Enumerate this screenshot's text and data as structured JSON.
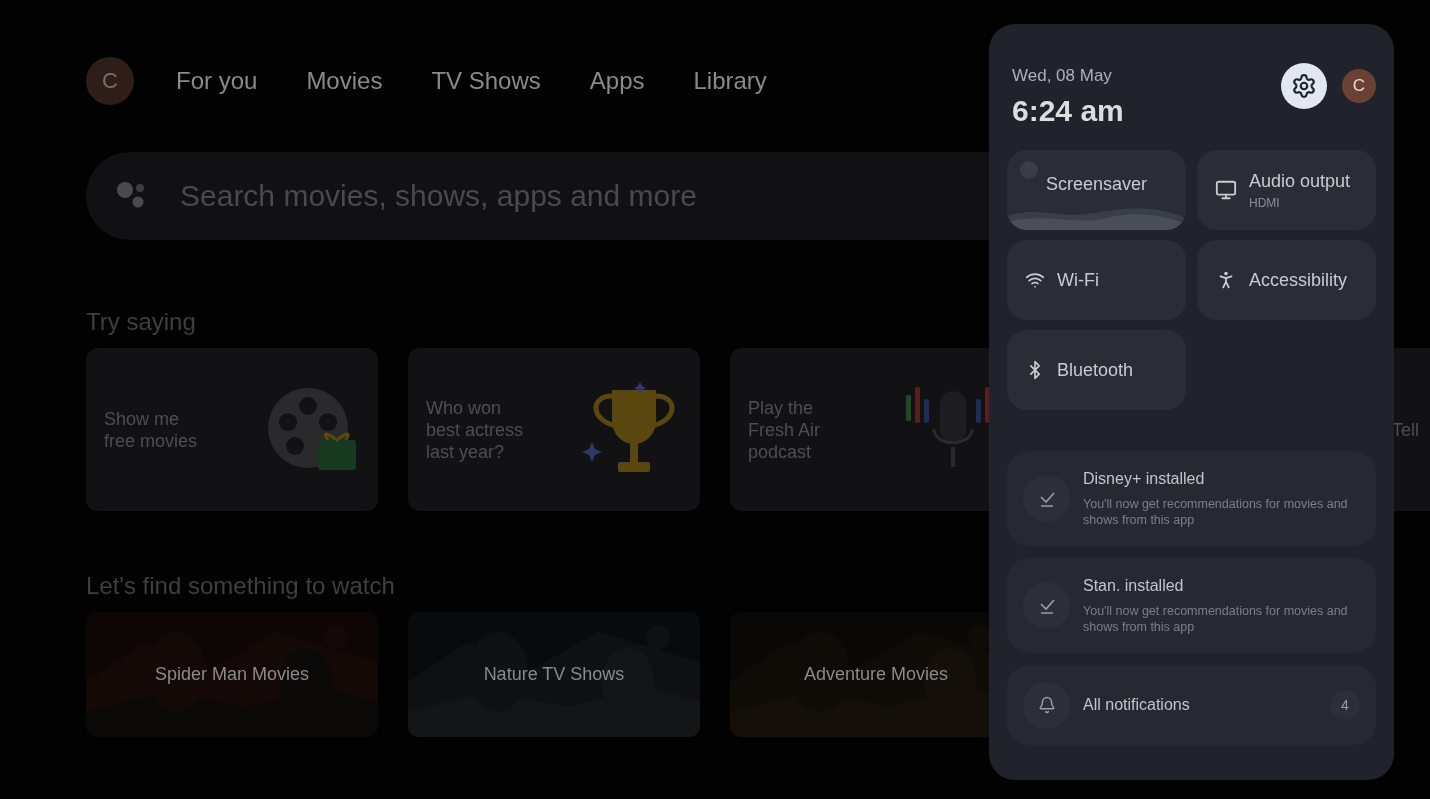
{
  "profile": {
    "initial": "C"
  },
  "nav": [
    {
      "label": "For you"
    },
    {
      "label": "Movies"
    },
    {
      "label": "TV Shows"
    },
    {
      "label": "Apps"
    },
    {
      "label": "Library"
    }
  ],
  "search": {
    "placeholder": "Search movies, shows, apps and more"
  },
  "try_saying": {
    "title": "Try saying",
    "cards": [
      {
        "text": "Show me free movies",
        "kind": "reel"
      },
      {
        "text": "Who won best actress last year?",
        "kind": "trophy"
      },
      {
        "text": "Play the Fresh Air podcast",
        "kind": "mic"
      },
      {
        "text": "Tell",
        "kind": "plain"
      }
    ]
  },
  "watch": {
    "title": "Let's find something to watch",
    "tiles": [
      {
        "label": "Spider Man Movies",
        "kind": "picture"
      },
      {
        "label": "Nature TV Shows",
        "kind": "picture"
      },
      {
        "label": "Adventure Movies",
        "kind": "picture"
      }
    ]
  },
  "panel": {
    "date": "Wed, 08 May",
    "time": "6:24 am",
    "avatar": "C",
    "tiles": [
      {
        "kind": "screensaver",
        "label": "Screensaver"
      },
      {
        "kind": "audio",
        "label": "Audio output",
        "sublabel": "HDMI"
      },
      {
        "kind": "wifi",
        "label": "Wi-Fi"
      },
      {
        "kind": "accessibility",
        "label": "Accessibility"
      },
      {
        "kind": "bluetooth",
        "label": "Bluetooth"
      }
    ],
    "notifications": [
      {
        "kind": "installed",
        "title": "Disney+ installed",
        "body": "You'll now get recommendations for movies and shows from this app"
      },
      {
        "kind": "installed",
        "title": "Stan. installed",
        "body": "You'll now get recommendations for movies and shows from this app"
      },
      {
        "kind": "all",
        "title": "All notifications",
        "count": "4"
      }
    ]
  }
}
